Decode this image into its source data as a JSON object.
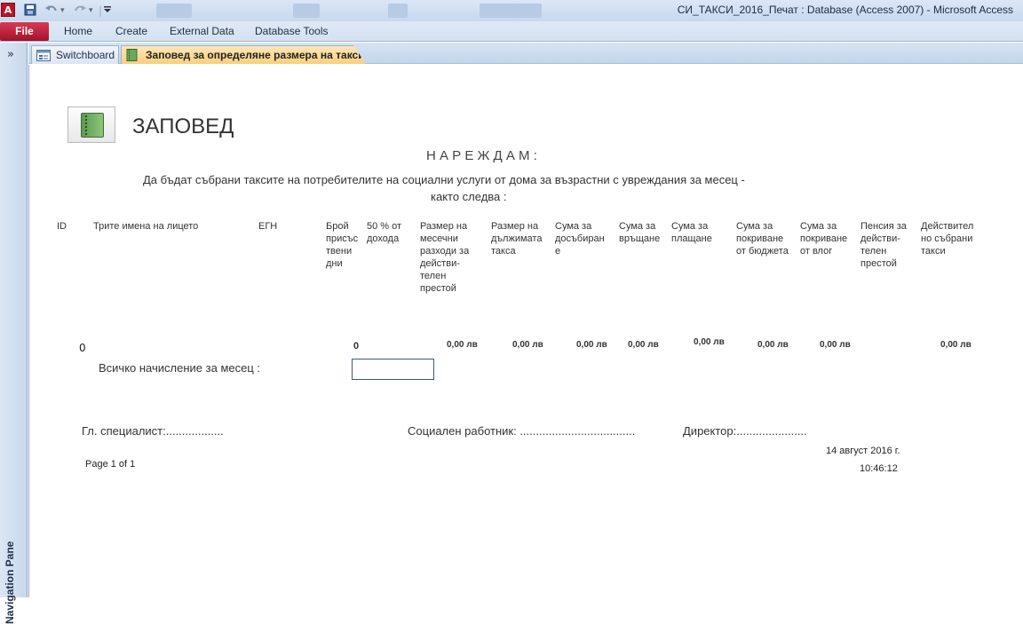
{
  "titlebar": {
    "app_icon": "A",
    "title": "СИ_ТАКСИ_2016_Печат : Database (Access 2007)  -  Microsoft Access",
    "qat": {
      "save_icon": "save-icon",
      "undo_icon": "undo-icon",
      "redo_icon": "redo-icon",
      "customize_icon": "dropdown-icon"
    }
  },
  "ribbon": {
    "file_label": "File",
    "tabs": [
      "Home",
      "Create",
      "External Data",
      "Database Tools"
    ]
  },
  "nav_pane": {
    "toggle": "»",
    "label": "Navigation Pane"
  },
  "doc_tabs": [
    {
      "label": "Switchboard",
      "icon": "form-icon"
    },
    {
      "label": "Заповед за определяне размера на таксите",
      "icon": "report-icon",
      "active": true
    }
  ],
  "report": {
    "title": "ЗАПОВЕД",
    "heading": "Н А Р Е Ж Д А М :",
    "intro_line1": "Да бъдат събрани таксите на потребителите на социални услуги от дома за възрастни с увреждания за месец  -",
    "intro_line2": "както следва :",
    "columns": [
      "ID",
      "Трите имена на лицето",
      "ЕГН",
      "Брой присъс твени дни",
      "50 % от дохода",
      "Размер на месечни разходи за действи-телен престой",
      "Размер на дължимата такса",
      "Сума за досъбиран е",
      "Сума за връщане",
      "Сума за плащане",
      "Сума за покриване от бюджета",
      "Сума за покриване от влог",
      "Пенсия за действи-телен престой",
      "Действител но събрани такси"
    ],
    "row": {
      "id": "0",
      "days": "0",
      "monthly_cost": "0,00 лв",
      "due_fee": "0,00 лв",
      "additional": "0,00 лв",
      "refund": "0,00 лв",
      "payment": "0,00 лв",
      "budget": "0,00 лв",
      "deposit": "0,00 лв",
      "collected": "0,00 лв"
    },
    "total_label": "Всичко начисление за месец  :",
    "total_value": "",
    "signatures": {
      "specialist": "Гл. специалист:..................",
      "social_worker": "Социален работник: ....................................",
      "director": "Директор:......................"
    },
    "page": "Page 1 of 1",
    "date": "14 август 2016 г.",
    "time": "10:46:12"
  }
}
